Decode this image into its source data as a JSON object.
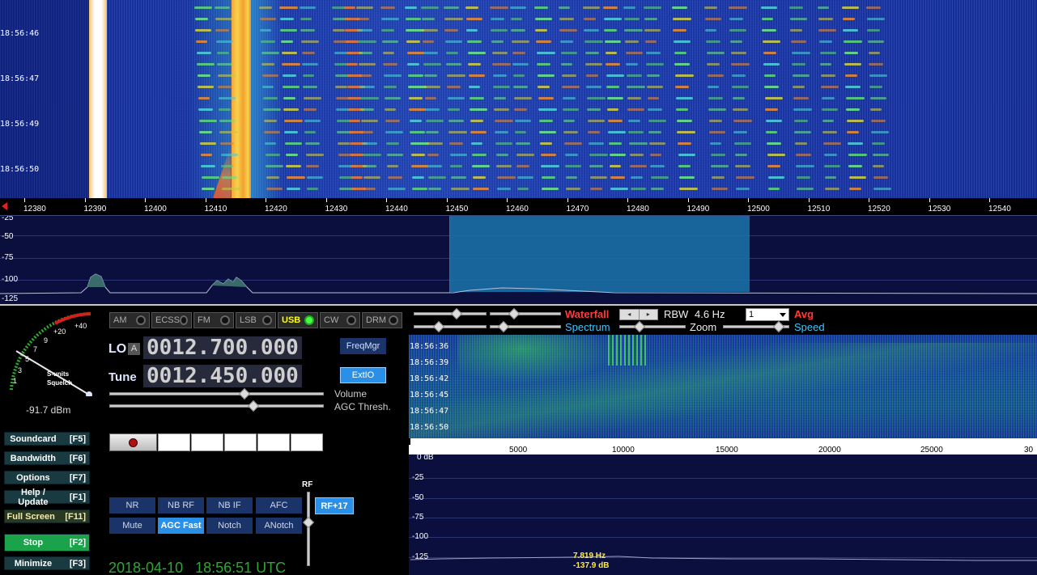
{
  "waterfall": {
    "timestamps": [
      "18:56:46",
      "18:56:47",
      "18:56:49",
      "18:56:50"
    ]
  },
  "freq_axis": {
    "ticks": [
      "12380",
      "12390",
      "12400",
      "12410",
      "12420",
      "12430",
      "12440",
      "12450",
      "12460",
      "12470",
      "12480",
      "12490",
      "12500",
      "12510",
      "12520",
      "12530",
      "12540"
    ]
  },
  "spectrum": {
    "y_ticks": [
      "-25",
      "-50",
      "-75",
      "-100",
      "-125"
    ]
  },
  "smeter": {
    "scale": [
      "1",
      "3",
      "5",
      "7",
      "9",
      "+20",
      "+40"
    ],
    "label_line1": "S-units",
    "label_line2": "Squelch",
    "reading": "-91.7 dBm"
  },
  "side_buttons": [
    {
      "label": "Soundcard",
      "key": "[F5]"
    },
    {
      "label": "Bandwidth",
      "key": "[F6]"
    },
    {
      "label": "Options",
      "key": "[F7]"
    },
    {
      "label": "Help / Update",
      "key": "[F1]"
    },
    {
      "label": "Full Screen",
      "key": "[F11]"
    },
    {
      "label": "Stop",
      "key": "[F2]"
    },
    {
      "label": "Minimize",
      "key": "[F3]"
    }
  ],
  "modes": [
    "AM",
    "ECSS",
    "FM",
    "LSB",
    "USB",
    "CW",
    "DRM"
  ],
  "active_mode": "USB",
  "lo": {
    "label": "LO",
    "badge": "A",
    "value": "0012.700.000"
  },
  "tune": {
    "label": "Tune",
    "value": "0012.450.000"
  },
  "freqmgr_label": "FreqMgr",
  "extio_label": "ExtIO",
  "volume_label": "Volume",
  "agc_label": "AGC Thresh.",
  "volume_level": 0.63,
  "agc_level": 0.67,
  "dsp_row1": [
    "NR",
    "NB RF",
    "NB IF",
    "AFC"
  ],
  "dsp_row2": [
    "Mute",
    "AGC Fast",
    "Notch",
    "ANotch"
  ],
  "rf_label": "RF",
  "rf_gain_button": "RF+17",
  "datetime": "2018-04-10   18:56:51 UTC",
  "right_controls": {
    "waterfall_label": "Waterfall",
    "spectrum_label": "Spectrum",
    "rbw_label": "RBW",
    "rbw_value": "4.6 Hz",
    "zoom_label": "Zoom",
    "avg_value": "1",
    "avg_label": "Avg",
    "speed_label": "Speed"
  },
  "audio_waterfall": {
    "timestamps": [
      "18:56:36",
      "18:56:39",
      "18:56:42",
      "18:56:45",
      "18:56:47",
      "18:56:50"
    ]
  },
  "audio_axis": {
    "ticks": [
      "5000",
      "10000",
      "15000",
      "20000",
      "25000",
      "30"
    ]
  },
  "audio_spectrum": {
    "y_ticks": [
      "0 dB",
      "-25",
      "-50",
      "-75",
      "-100",
      "-125"
    ],
    "cursor_freq": "7.819 Hz",
    "cursor_level": "-137.9 dB"
  },
  "colors": {
    "accent": "#2a8fe6",
    "side_btn": "#1a3a42",
    "stop_btn": "#1aa34a",
    "spectrum_bg": "#0a0f3d",
    "waterfall_label": "#ff3b3b",
    "spectrum_label": "#3fc6ff"
  }
}
